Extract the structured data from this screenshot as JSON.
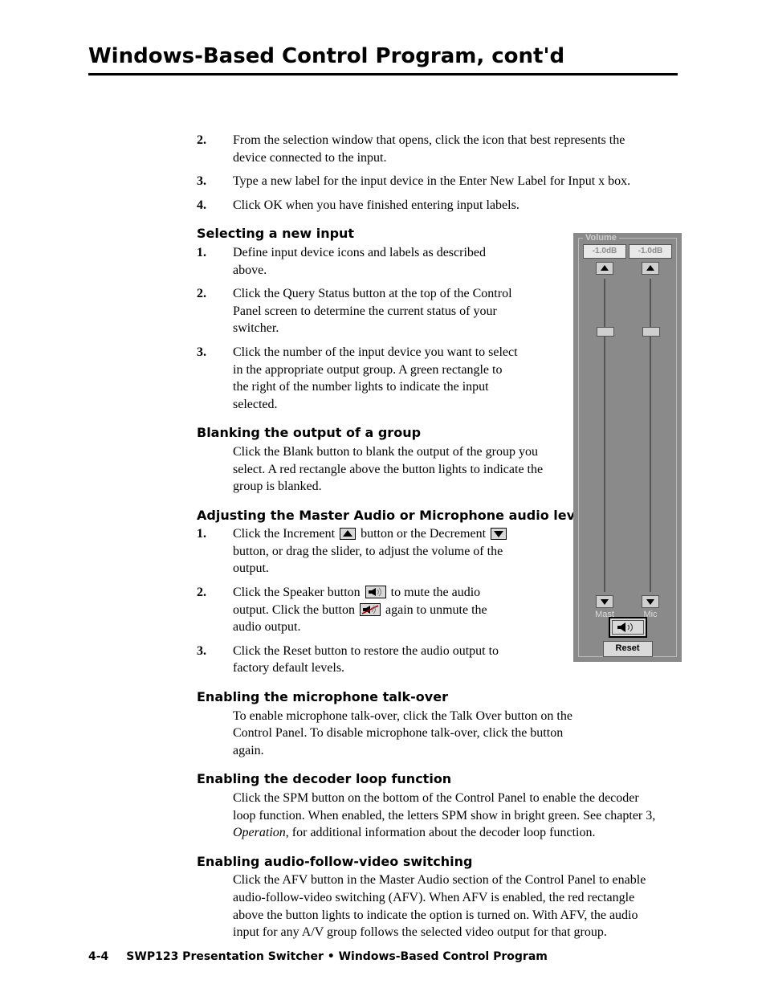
{
  "title": "Windows-Based Control Program, cont'd",
  "intro_steps": [
    {
      "n": "2.",
      "t": "From the selection window that opens, click the icon that best represents the device connected to the input."
    },
    {
      "n": "3.",
      "t": "Type a new label for the input device in the Enter New Label for Input x box."
    },
    {
      "n": "4.",
      "t": "Click OK when you have finished entering input labels."
    }
  ],
  "sec1": {
    "title": "Selecting a new input",
    "steps": [
      {
        "n": "1.",
        "t": "Define input device icons and labels as described above."
      },
      {
        "n": "2.",
        "t": "Click the Query Status button at the top of the Control Panel screen to determine the current status of your switcher."
      },
      {
        "n": "3.",
        "t": "Click the number of the input device you want to select in the appropriate output group.  A green rectangle to the right of the number lights to indicate the input selected."
      }
    ]
  },
  "sec2": {
    "title": "Blanking the output of a group",
    "body": "Click the Blank button to blank the output of the group you select.  A red rectangle above the button lights to indicate the group is blanked."
  },
  "sec3": {
    "title": "Adjusting the Master Audio or Microphone audio level",
    "s1a": "Click the Increment ",
    "s1b": " button or the Decrement ",
    "s1c": " button, or drag the slider, to adjust the volume of the output.",
    "s2a": "Click the Speaker button ",
    "s2b": " to mute the audio output.  Click the button ",
    "s2c": " again to unmute the audio output.",
    "s3": "Click the Reset button to restore the audio output to factory default levels."
  },
  "sec4": {
    "title": "Enabling the microphone talk-over",
    "body": "To enable microphone talk-over, click the Talk Over button on the Control Panel.  To disable microphone talk-over, click the button again."
  },
  "sec5": {
    "title": "Enabling the decoder loop function",
    "a": "Click the SPM button on the bottom of the Control Panel to enable the decoder loop function.  When enabled, the letters SPM show in bright green. See chapter 3, ",
    "b": "Operation",
    "c": ", for additional information about the decoder loop function."
  },
  "sec6": {
    "title": "Enabling audio-follow-video switching",
    "body": "Click the AFV button in the Master Audio section of the Control Panel to enable audio-follow-video switching (AFV).  When AFV is enabled, the red rectangle above the button lights to indicate the option is turned on.  With AFV, the audio input for any A/V group follows the selected video output for that group."
  },
  "volume": {
    "frame": "Volume",
    "db": "-1.0dB",
    "mast": "Mast",
    "mic": "Mic",
    "reset": "Reset"
  },
  "footer": {
    "page": "4-4",
    "text": "SWP123 Presentation Switcher • Windows-Based Control Program"
  }
}
